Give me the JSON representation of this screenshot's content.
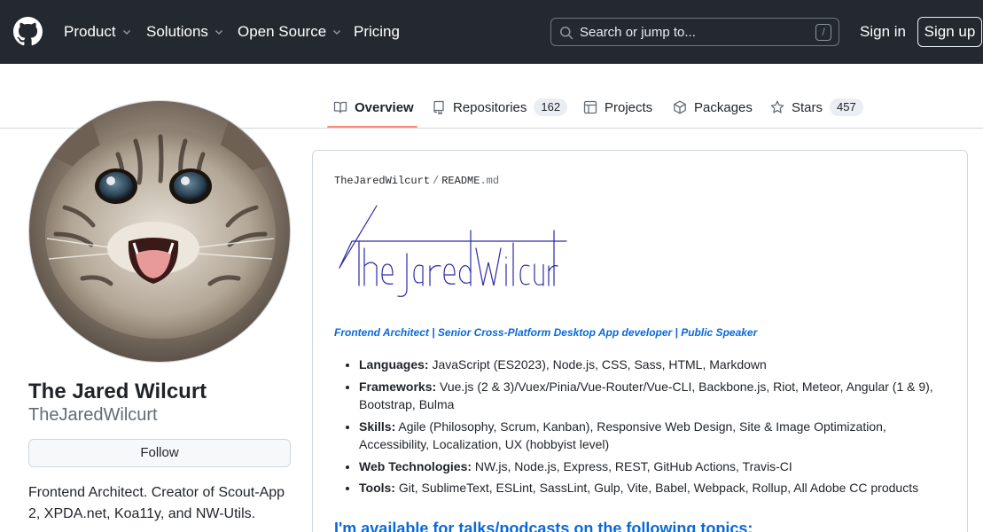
{
  "header": {
    "nav": [
      {
        "label": "Product",
        "has_dropdown": true
      },
      {
        "label": "Solutions",
        "has_dropdown": true
      },
      {
        "label": "Open Source",
        "has_dropdown": true
      },
      {
        "label": "Pricing",
        "has_dropdown": false
      }
    ],
    "search_placeholder": "Search or jump to...",
    "search_shortcut": "/",
    "sign_in": "Sign in",
    "sign_up": "Sign up",
    "logo_icon": "github-mark-icon"
  },
  "tabs": [
    {
      "label": "Overview",
      "icon": "book-icon",
      "count": null,
      "selected": true
    },
    {
      "label": "Repositories",
      "icon": "repo-icon",
      "count": "162",
      "selected": false
    },
    {
      "label": "Projects",
      "icon": "table-icon",
      "count": null,
      "selected": false
    },
    {
      "label": "Packages",
      "icon": "package-icon",
      "count": null,
      "selected": false
    },
    {
      "label": "Stars",
      "icon": "star-icon",
      "count": "457",
      "selected": false
    }
  ],
  "profile": {
    "full_name": "The Jared Wilcurt",
    "username": "TheJaredWilcurt",
    "follow_label": "Follow",
    "bio": "Frontend Architect. Creator of Scout-App 2, XPDA.net, Koa11y, and NW-Utils."
  },
  "readme": {
    "owner": "TheJaredWilcurt",
    "separator": "/",
    "file_base": "README",
    "file_ext": ".md",
    "signature_text": "TheJaredWilcurt",
    "tagline": "Frontend Architect | Senior Cross-Platform Desktop App developer | Public Speaker",
    "skills": [
      {
        "label": "Languages:",
        "text": " JavaScript (ES2023), Node.js, CSS, Sass, HTML, Markdown"
      },
      {
        "label": "Frameworks:",
        "text": " Vue.js (2 & 3)/Vuex/Pinia/Vue-Router/Vue-CLI, Backbone.js, Riot, Meteor, Angular (1 & 9), Bootstrap, Bulma"
      },
      {
        "label": "Skills:",
        "text": " Agile (Philosophy, Scrum, Kanban), Responsive Web Design, Site & Image Optimization, Accessibility, Localization, UX (hobbyist level)"
      },
      {
        "label": "Web Technologies:",
        "text": " NW.js, Node.js, Express, REST, GitHub Actions, Travis-CI"
      },
      {
        "label": "Tools:",
        "text": " Git, SublimeText, ESLint, SassLint, Gulp, Vite, Babel, Webpack, Rollup, All Adobe CC products"
      }
    ],
    "talks_heading": "I'm available for talks/podcasts on the following topics:"
  },
  "colors": {
    "header_bg": "#24292f",
    "accent_link": "#0969da",
    "tab_underline": "#fd8c73",
    "signature_ink": "#2a2aa8"
  }
}
